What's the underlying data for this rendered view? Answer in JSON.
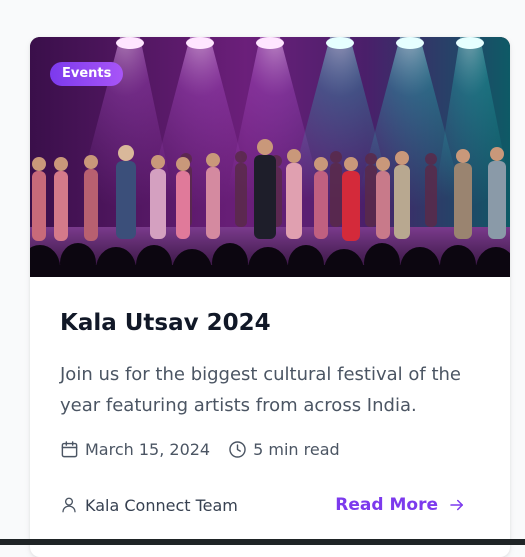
{
  "card": {
    "badge": "Events",
    "image_alt": "Concert stage with performers",
    "title": "Kala Utsav 2024",
    "description": "Join us for the biggest cultural festival of the year featuring artists from across India.",
    "date": "March 15, 2024",
    "read_time": "5 min read",
    "author": "Kala Connect Team",
    "cta": "Read More"
  },
  "icons": {
    "date": "calendar-icon",
    "read_time": "clock-icon",
    "author": "user-icon",
    "cta": "arrow-right-icon"
  },
  "colors": {
    "accent": "#7c3aed",
    "title": "#111827",
    "text": "#4b5563",
    "badge_gradient": [
      "#7c3aed",
      "#a855f7"
    ]
  }
}
